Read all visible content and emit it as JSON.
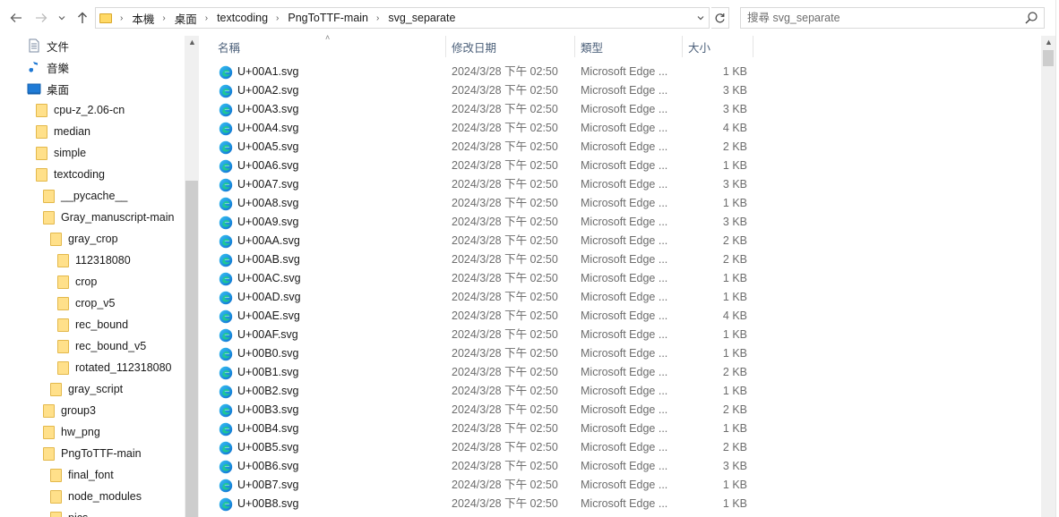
{
  "toolbar": {
    "back_icon": "arrow-left-icon",
    "forward_icon": "arrow-right-icon",
    "recent_icon": "chevron-down-icon",
    "up_icon": "arrow-up-icon",
    "breadcrumb": [
      "本機",
      "桌面",
      "textcoding",
      "PngToTTF-main",
      "svg_separate"
    ],
    "refresh_icon": "refresh-icon",
    "search_placeholder": "搜尋 svg_separate"
  },
  "navpane": {
    "items": [
      {
        "label": "文件",
        "icon": "documents-icon",
        "indent": 0
      },
      {
        "label": "音樂",
        "icon": "music-icon",
        "indent": 0
      },
      {
        "label": "桌面",
        "icon": "desktop-icon",
        "indent": 0
      },
      {
        "label": "cpu-z_2.06-cn",
        "icon": "folder-icon",
        "indent": 1
      },
      {
        "label": "median",
        "icon": "folder-icon",
        "indent": 1
      },
      {
        "label": "simple",
        "icon": "folder-icon",
        "indent": 1
      },
      {
        "label": "textcoding",
        "icon": "folder-icon",
        "indent": 1
      },
      {
        "label": "__pycache__",
        "icon": "folder-icon",
        "indent": 2
      },
      {
        "label": "Gray_manuscript-main",
        "icon": "folder-icon",
        "indent": 2
      },
      {
        "label": "gray_crop",
        "icon": "folder-icon",
        "indent": 3
      },
      {
        "label": "112318080",
        "icon": "folder-icon",
        "indent": 4
      },
      {
        "label": "crop",
        "icon": "folder-icon",
        "indent": 4
      },
      {
        "label": "crop_v5",
        "icon": "folder-icon",
        "indent": 4
      },
      {
        "label": "rec_bound",
        "icon": "folder-icon",
        "indent": 4
      },
      {
        "label": "rec_bound_v5",
        "icon": "folder-icon",
        "indent": 4
      },
      {
        "label": "rotated_112318080",
        "icon": "folder-icon",
        "indent": 4
      },
      {
        "label": "gray_script",
        "icon": "folder-icon",
        "indent": 3
      },
      {
        "label": "group3",
        "icon": "folder-icon",
        "indent": 2
      },
      {
        "label": "hw_png",
        "icon": "folder-icon",
        "indent": 2
      },
      {
        "label": "PngToTTF-main",
        "icon": "folder-icon",
        "indent": 2
      },
      {
        "label": "final_font",
        "icon": "folder-icon",
        "indent": 3
      },
      {
        "label": "node_modules",
        "icon": "folder-icon",
        "indent": 3
      },
      {
        "label": "pics",
        "icon": "folder-icon",
        "indent": 3
      }
    ]
  },
  "columns": {
    "name": "名稱",
    "date": "修改日期",
    "type": "類型",
    "size": "大小"
  },
  "files": [
    {
      "name": "U+00A1.svg",
      "date": "2024/3/28 下午 02:50",
      "type": "Microsoft Edge ...",
      "size": "1 KB"
    },
    {
      "name": "U+00A2.svg",
      "date": "2024/3/28 下午 02:50",
      "type": "Microsoft Edge ...",
      "size": "3 KB"
    },
    {
      "name": "U+00A3.svg",
      "date": "2024/3/28 下午 02:50",
      "type": "Microsoft Edge ...",
      "size": "3 KB"
    },
    {
      "name": "U+00A4.svg",
      "date": "2024/3/28 下午 02:50",
      "type": "Microsoft Edge ...",
      "size": "4 KB"
    },
    {
      "name": "U+00A5.svg",
      "date": "2024/3/28 下午 02:50",
      "type": "Microsoft Edge ...",
      "size": "2 KB"
    },
    {
      "name": "U+00A6.svg",
      "date": "2024/3/28 下午 02:50",
      "type": "Microsoft Edge ...",
      "size": "1 KB"
    },
    {
      "name": "U+00A7.svg",
      "date": "2024/3/28 下午 02:50",
      "type": "Microsoft Edge ...",
      "size": "3 KB"
    },
    {
      "name": "U+00A8.svg",
      "date": "2024/3/28 下午 02:50",
      "type": "Microsoft Edge ...",
      "size": "1 KB"
    },
    {
      "name": "U+00A9.svg",
      "date": "2024/3/28 下午 02:50",
      "type": "Microsoft Edge ...",
      "size": "3 KB"
    },
    {
      "name": "U+00AA.svg",
      "date": "2024/3/28 下午 02:50",
      "type": "Microsoft Edge ...",
      "size": "2 KB"
    },
    {
      "name": "U+00AB.svg",
      "date": "2024/3/28 下午 02:50",
      "type": "Microsoft Edge ...",
      "size": "2 KB"
    },
    {
      "name": "U+00AC.svg",
      "date": "2024/3/28 下午 02:50",
      "type": "Microsoft Edge ...",
      "size": "1 KB"
    },
    {
      "name": "U+00AD.svg",
      "date": "2024/3/28 下午 02:50",
      "type": "Microsoft Edge ...",
      "size": "1 KB"
    },
    {
      "name": "U+00AE.svg",
      "date": "2024/3/28 下午 02:50",
      "type": "Microsoft Edge ...",
      "size": "4 KB"
    },
    {
      "name": "U+00AF.svg",
      "date": "2024/3/28 下午 02:50",
      "type": "Microsoft Edge ...",
      "size": "1 KB"
    },
    {
      "name": "U+00B0.svg",
      "date": "2024/3/28 下午 02:50",
      "type": "Microsoft Edge ...",
      "size": "1 KB"
    },
    {
      "name": "U+00B1.svg",
      "date": "2024/3/28 下午 02:50",
      "type": "Microsoft Edge ...",
      "size": "2 KB"
    },
    {
      "name": "U+00B2.svg",
      "date": "2024/3/28 下午 02:50",
      "type": "Microsoft Edge ...",
      "size": "1 KB"
    },
    {
      "name": "U+00B3.svg",
      "date": "2024/3/28 下午 02:50",
      "type": "Microsoft Edge ...",
      "size": "2 KB"
    },
    {
      "name": "U+00B4.svg",
      "date": "2024/3/28 下午 02:50",
      "type": "Microsoft Edge ...",
      "size": "1 KB"
    },
    {
      "name": "U+00B5.svg",
      "date": "2024/3/28 下午 02:50",
      "type": "Microsoft Edge ...",
      "size": "2 KB"
    },
    {
      "name": "U+00B6.svg",
      "date": "2024/3/28 下午 02:50",
      "type": "Microsoft Edge ...",
      "size": "3 KB"
    },
    {
      "name": "U+00B7.svg",
      "date": "2024/3/28 下午 02:50",
      "type": "Microsoft Edge ...",
      "size": "1 KB"
    },
    {
      "name": "U+00B8.svg",
      "date": "2024/3/28 下午 02:50",
      "type": "Microsoft Edge ...",
      "size": "1 KB"
    }
  ]
}
